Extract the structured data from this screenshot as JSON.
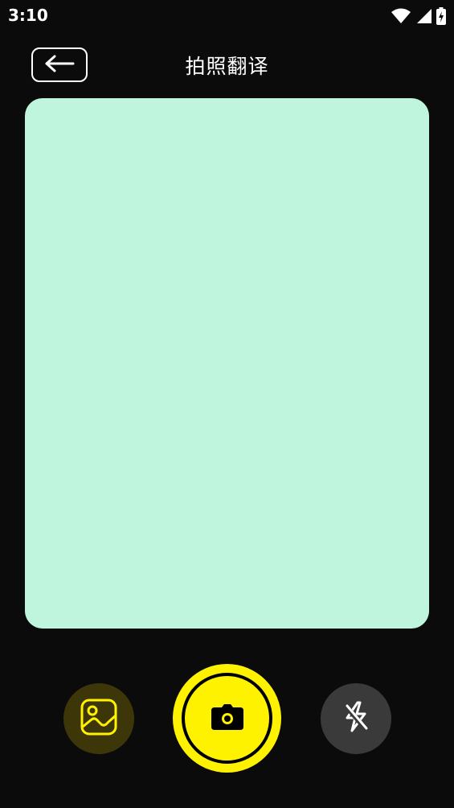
{
  "status_bar": {
    "time": "3:10",
    "icons": [
      "wifi-icon",
      "cell-signal-icon",
      "battery-charging-icon"
    ]
  },
  "header": {
    "back_icon": "arrow-left-icon",
    "title": "拍照翻译"
  },
  "controls": {
    "gallery_icon": "image-gallery-icon",
    "shutter_icon": "camera-icon",
    "flash_icon": "flash-off-icon"
  },
  "colors": {
    "background": "#0b0b0b",
    "preview": "#bff5dc",
    "accent_yellow": "#fff200",
    "gallery_bg": "#3d3608",
    "flash_bg": "#3a3a3a",
    "icon_dark": "#000000",
    "text": "#ffffff"
  }
}
